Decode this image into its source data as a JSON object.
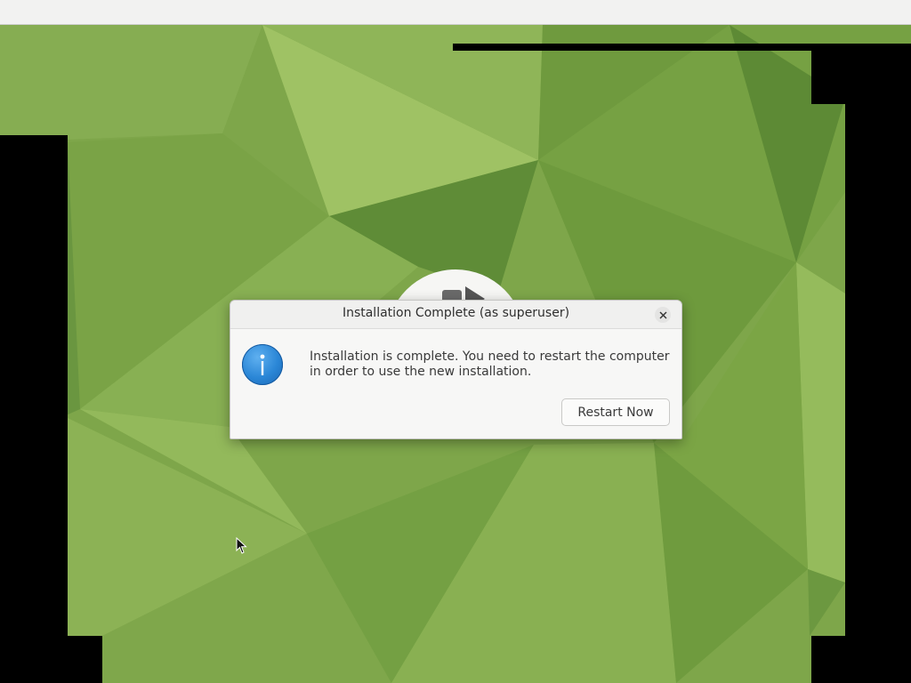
{
  "desktop": {
    "wallpaper_base_color": "#7ea64a",
    "wallpaper_dark_color": "#5f8a35",
    "wallpaper_light_color": "#9cc05f"
  },
  "dialog": {
    "title": "Installation Complete (as superuser)",
    "message": "Installation is complete. You need to restart the computer in order to use the new installation.",
    "icon": "info-icon",
    "close_icon": "close-icon",
    "primary_button_label": "Restart Now",
    "icon_color": "#2a86d6"
  },
  "pointer": {
    "icon": "mouse-pointer-icon"
  }
}
